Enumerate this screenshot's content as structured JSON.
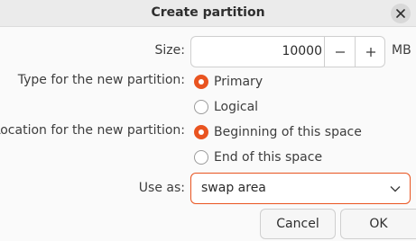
{
  "window": {
    "title": "Create partition",
    "close_icon": "close-icon"
  },
  "size": {
    "label": "Size:",
    "value": "10000",
    "decrement_icon": "minus-icon",
    "increment_icon": "plus-icon",
    "unit": "MB"
  },
  "type": {
    "label": "Type for the new partition:",
    "options": [
      {
        "label": "Primary",
        "selected": true
      },
      {
        "label": "Logical",
        "selected": false
      }
    ]
  },
  "location": {
    "label": "Location for the new partition:",
    "options": [
      {
        "label": "Beginning of this space",
        "selected": true
      },
      {
        "label": "End of this space",
        "selected": false
      }
    ]
  },
  "use_as": {
    "label": "Use as:",
    "value": "swap area",
    "dropdown_icon": "chevron-down-icon"
  },
  "buttons": {
    "cancel": "Cancel",
    "ok": "OK"
  },
  "colors": {
    "accent": "#e95420",
    "titlebar": "#ebebeb",
    "background": "#fafafa"
  }
}
